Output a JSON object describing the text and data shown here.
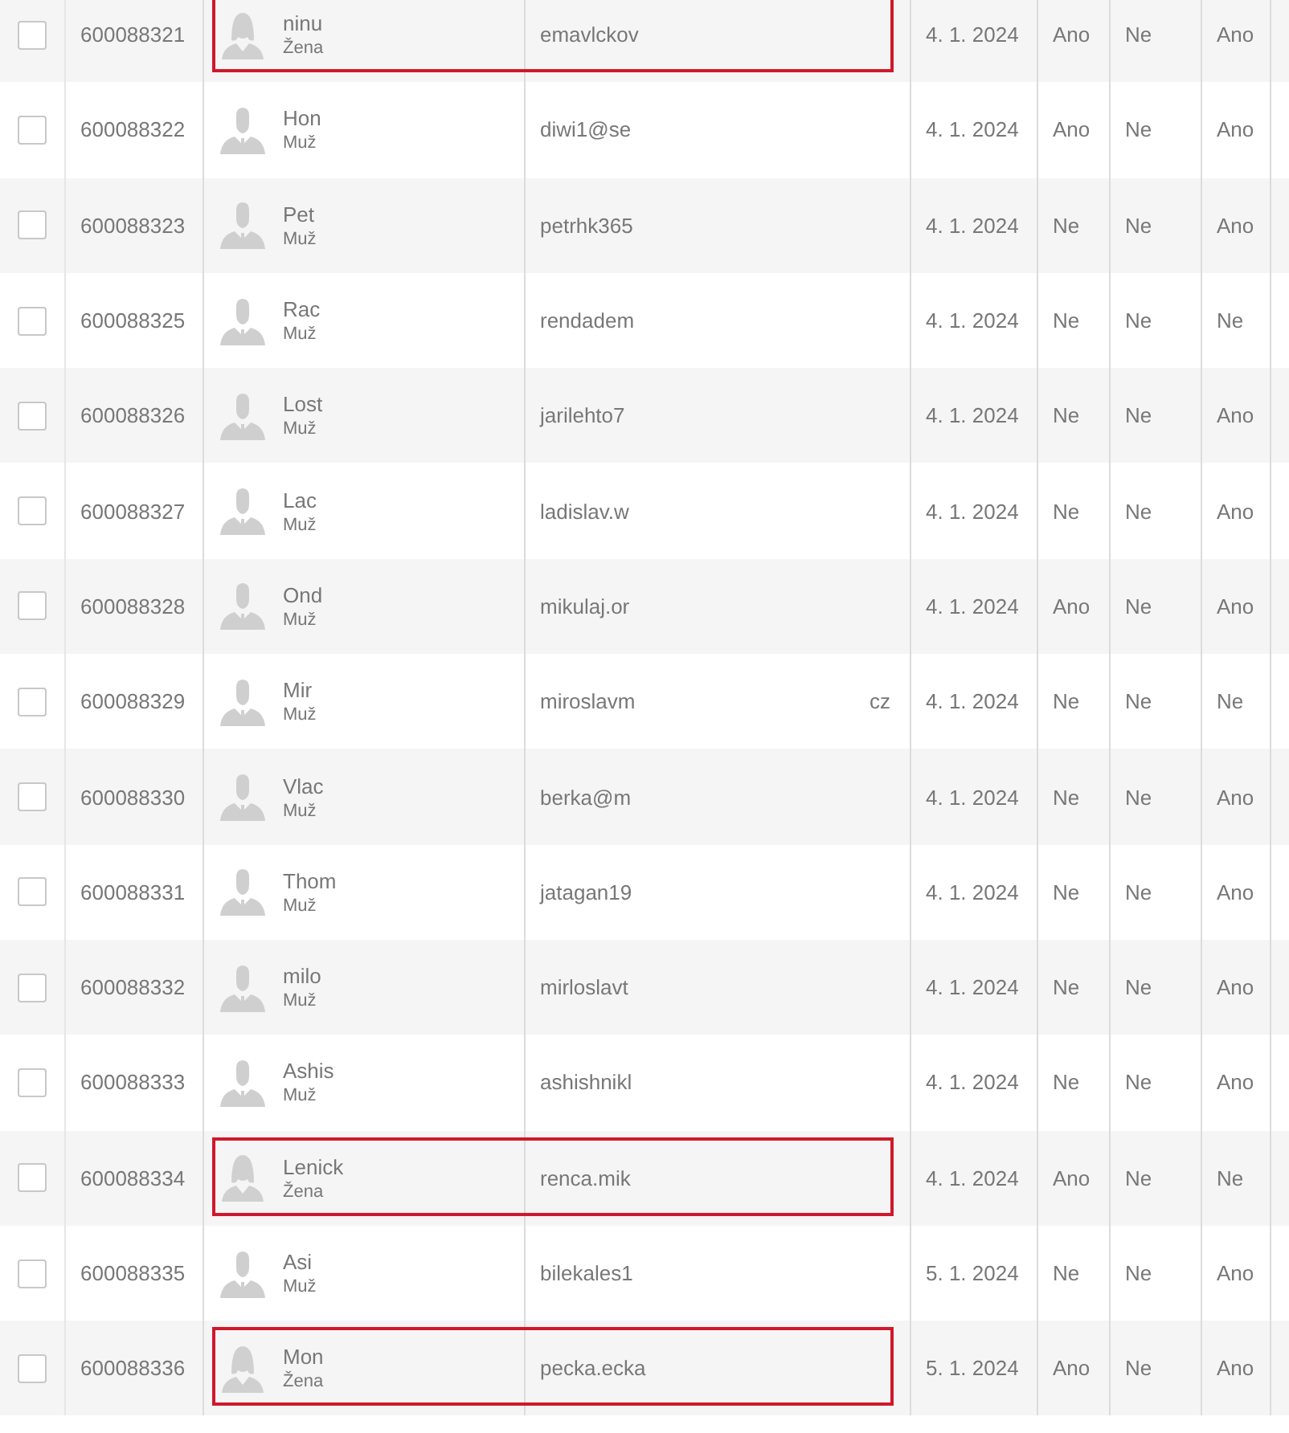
{
  "rows": [
    {
      "id": "600088321",
      "name": "ninu",
      "gender": "Žena",
      "kind": "female",
      "email": "emavlckov",
      "date": "4. 1. 2024",
      "col_5": "Ano",
      "col_6": "Ne",
      "col_7": "Ano",
      "checked": false,
      "highlighted": true
    },
    {
      "id": "600088322",
      "name": "Hon",
      "gender": "Muž",
      "kind": "male",
      "email": "diwi1@se",
      "date": "4. 1. 2024",
      "col_5": "Ano",
      "col_6": "Ne",
      "col_7": "Ano",
      "checked": false,
      "highlighted": false
    },
    {
      "id": "600088323",
      "name": "Pet",
      "gender": "Muž",
      "kind": "male",
      "email": "petrhk365",
      "date": "4. 1. 2024",
      "col_5": "Ne",
      "col_6": "Ne",
      "col_7": "Ano",
      "checked": false,
      "highlighted": false
    },
    {
      "id": "600088325",
      "name": "Rac",
      "gender": "Muž",
      "kind": "male",
      "email": "rendadem",
      "date": "4. 1. 2024",
      "col_5": "Ne",
      "col_6": "Ne",
      "col_7": "Ne",
      "checked": false,
      "highlighted": false
    },
    {
      "id": "600088326",
      "name": "Lost",
      "gender": "Muž",
      "kind": "male",
      "email": "jarilehto7",
      "date": "4. 1. 2024",
      "col_5": "Ne",
      "col_6": "Ne",
      "col_7": "Ano",
      "checked": false,
      "highlighted": false
    },
    {
      "id": "600088327",
      "name": "Lac",
      "gender": "Muž",
      "kind": "male",
      "email": "ladislav.w",
      "date": "4. 1. 2024",
      "col_5": "Ne",
      "col_6": "Ne",
      "col_7": "Ano",
      "checked": false,
      "highlighted": false
    },
    {
      "id": "600088328",
      "name": "Ond",
      "gender": "Muž",
      "kind": "male",
      "email": "mikulaj.or",
      "date": "4. 1. 2024",
      "col_5": "Ano",
      "col_6": "Ne",
      "col_7": "Ano",
      "checked": false,
      "highlighted": false
    },
    {
      "id": "600088329",
      "name": "Mir",
      "gender": "Muž",
      "kind": "male",
      "email": "miroslavm",
      "email_tail": "cz",
      "date": "4. 1. 2024",
      "col_5": "Ne",
      "col_6": "Ne",
      "col_7": "Ne",
      "checked": false,
      "highlighted": false
    },
    {
      "id": "600088330",
      "name": "Vlac",
      "gender": "Muž",
      "kind": "male",
      "email": "berka@m",
      "date": "4. 1. 2024",
      "col_5": "Ne",
      "col_6": "Ne",
      "col_7": "Ano",
      "checked": false,
      "highlighted": false
    },
    {
      "id": "600088331",
      "name": "Thom",
      "gender": "Muž",
      "kind": "male",
      "email": "jatagan19",
      "date": "4. 1. 2024",
      "col_5": "Ne",
      "col_6": "Ne",
      "col_7": "Ano",
      "checked": false,
      "highlighted": false
    },
    {
      "id": "600088332",
      "name": "milo",
      "gender": "Muž",
      "kind": "male",
      "email": "mirloslavt",
      "date": "4. 1. 2024",
      "col_5": "Ne",
      "col_6": "Ne",
      "col_7": "Ano",
      "checked": false,
      "highlighted": false
    },
    {
      "id": "600088333",
      "name": "Ashis",
      "gender": "Muž",
      "kind": "male",
      "email": "ashishnikl",
      "date": "4. 1. 2024",
      "col_5": "Ne",
      "col_6": "Ne",
      "col_7": "Ano",
      "checked": false,
      "highlighted": false
    },
    {
      "id": "600088334",
      "name": "Lenick",
      "gender": "Žena",
      "kind": "female",
      "email": "renca.mik",
      "date": "4. 1. 2024",
      "col_5": "Ano",
      "col_6": "Ne",
      "col_7": "Ne",
      "checked": false,
      "highlighted": true
    },
    {
      "id": "600088335",
      "name": "Asi",
      "gender": "Muž",
      "kind": "male",
      "email": "bilekales1",
      "date": "5. 1. 2024",
      "col_5": "Ne",
      "col_6": "Ne",
      "col_7": "Ano",
      "checked": false,
      "highlighted": false
    },
    {
      "id": "600088336",
      "name": "Mon",
      "gender": "Žena",
      "kind": "female",
      "email": "pecka.ecka",
      "date": "5. 1. 2024",
      "col_5": "Ano",
      "col_6": "Ne",
      "col_7": "Ano",
      "checked": false,
      "highlighted": true
    }
  ]
}
